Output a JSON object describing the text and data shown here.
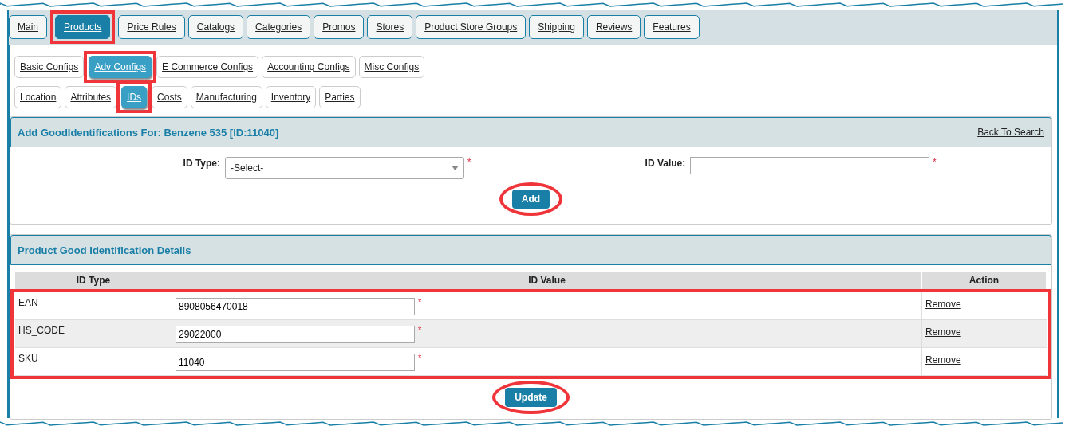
{
  "main_tabs": [
    {
      "label": "Main",
      "selected": false,
      "annotated": false
    },
    {
      "label": "Products",
      "selected": true,
      "annotated": true
    },
    {
      "label": "Price Rules",
      "selected": false,
      "annotated": false
    },
    {
      "label": "Catalogs",
      "selected": false,
      "annotated": false
    },
    {
      "label": "Categories",
      "selected": false,
      "annotated": false
    },
    {
      "label": "Promos",
      "selected": false,
      "annotated": false
    },
    {
      "label": "Stores",
      "selected": false,
      "annotated": false
    },
    {
      "label": "Product Store Groups",
      "selected": false,
      "annotated": false
    },
    {
      "label": "Shipping",
      "selected": false,
      "annotated": false
    },
    {
      "label": "Reviews",
      "selected": false,
      "annotated": false
    },
    {
      "label": "Features",
      "selected": false,
      "annotated": false
    }
  ],
  "config_tabs": [
    {
      "label": "Basic Configs",
      "selected": false,
      "annotated": false
    },
    {
      "label": "Adv Configs",
      "selected": true,
      "annotated": true
    },
    {
      "label": "E Commerce Configs",
      "selected": false,
      "annotated": false
    },
    {
      "label": "Accounting Configs",
      "selected": false,
      "annotated": false
    },
    {
      "label": "Misc Configs",
      "selected": false,
      "annotated": false
    }
  ],
  "section_tabs": [
    {
      "label": "Location",
      "selected": false,
      "annotated": false
    },
    {
      "label": "Attributes",
      "selected": false,
      "annotated": false
    },
    {
      "label": "IDs",
      "selected": true,
      "annotated": true
    },
    {
      "label": "Costs",
      "selected": false,
      "annotated": false
    },
    {
      "label": "Manufacturing",
      "selected": false,
      "annotated": false
    },
    {
      "label": "Inventory",
      "selected": false,
      "annotated": false
    },
    {
      "label": "Parties",
      "selected": false,
      "annotated": false
    }
  ],
  "add_panel": {
    "title": "Add GoodIdentifications For: Benzene 535 [ID:11040]",
    "back_link": "Back To Search",
    "id_type": {
      "label": "ID Type:",
      "value": "-Select-",
      "required_mark": "*"
    },
    "id_value": {
      "label": "ID Value:",
      "required_mark": "*"
    },
    "button": {
      "label": "Add",
      "annotated": true
    }
  },
  "details_panel": {
    "title": "Product Good Identification Details",
    "columns": [
      "ID Type",
      "ID Value",
      "Action"
    ],
    "rows_annotated": true,
    "rows": [
      {
        "id_type": "EAN",
        "id_value": "8908056470018",
        "required_mark": "*",
        "action": "Remove"
      },
      {
        "id_type": "HS_CODE",
        "id_value": "29022000",
        "required_mark": "*",
        "action": "Remove"
      },
      {
        "id_type": "SKU",
        "id_value": "11040",
        "required_mark": "*",
        "action": "Remove"
      }
    ],
    "button": {
      "label": "Update",
      "annotated": true
    }
  }
}
